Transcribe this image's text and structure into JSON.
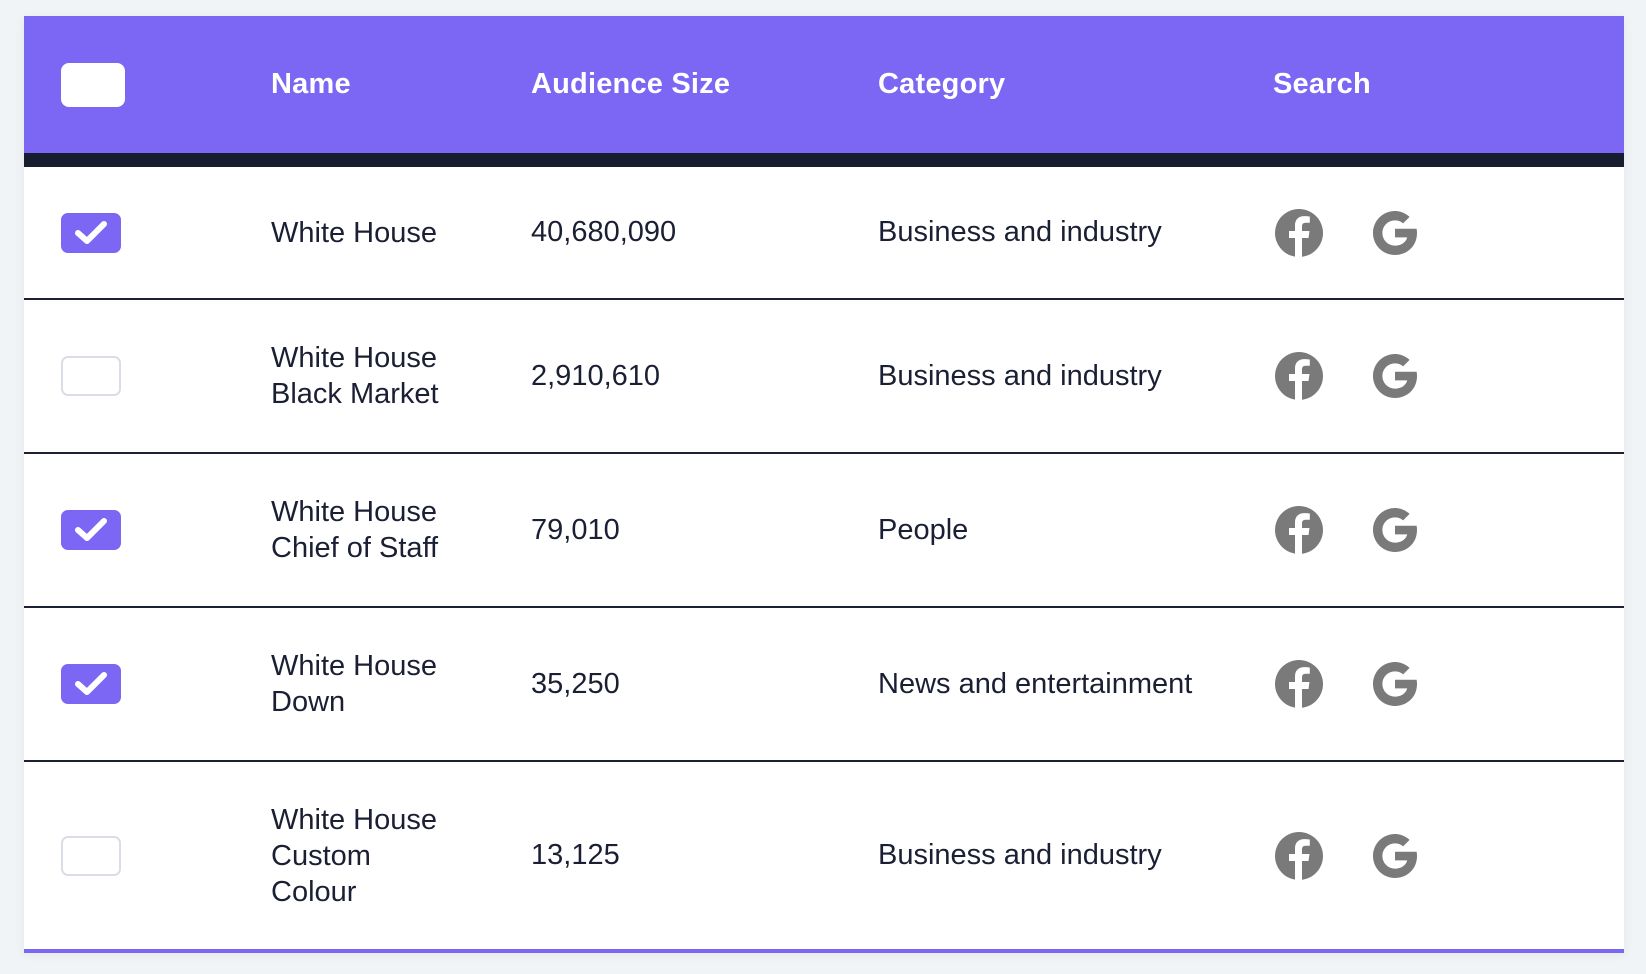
{
  "header": {
    "name": "Name",
    "audience_size": "Audience Size",
    "category": "Category",
    "search": "Search"
  },
  "rows": [
    {
      "name": "White House",
      "audience_size": "40,680,090",
      "category": "Business and industry",
      "checked": true
    },
    {
      "name": "White House\nBlack Market",
      "audience_size": "2,910,610",
      "category": "Business and industry",
      "checked": false
    },
    {
      "name": "White House\nChief of Staff",
      "audience_size": "79,010",
      "category": "People",
      "checked": true
    },
    {
      "name": "White House\nDown",
      "audience_size": "35,250",
      "category": "News and entertainment",
      "checked": true
    },
    {
      "name": "White House\nCustom\nColour",
      "audience_size": "13,125",
      "category": "Business and industry",
      "checked": false
    }
  ],
  "icons": {
    "search_facebook": "facebook-icon",
    "search_google": "google-icon",
    "checkmark": "checkmark-icon"
  },
  "colors": {
    "accent": "#7c66f4",
    "header_border": "#181c2f",
    "icon_gray": "#7a7a7a",
    "text": "#1b1f33"
  }
}
